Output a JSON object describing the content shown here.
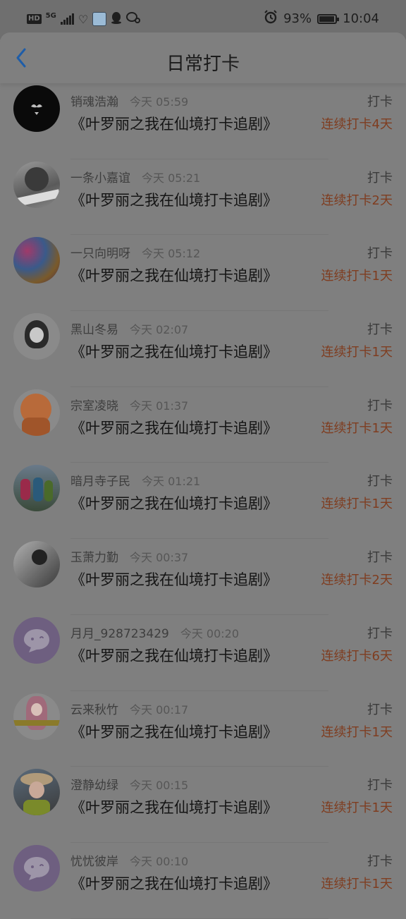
{
  "status_bar": {
    "hd": "HD",
    "network": "5G",
    "battery": "93%",
    "battery_level": 0.93,
    "time": "10:04",
    "icons": [
      "hd-icon",
      "5g-icon",
      "signal-icon",
      "heart-icon",
      "app-icon",
      "qq-icon",
      "chat-icon",
      "alarm-icon",
      "battery-icon"
    ]
  },
  "header": {
    "title": "日常打卡",
    "back_icon": "chevron-left-icon",
    "accent": "#1e5da8"
  },
  "colors": {
    "streak": "#7f3d20",
    "overlay_bg": "#7f7f7f"
  },
  "items": [
    {
      "username": "销魂浩瀚",
      "time": "今天 05:59",
      "book": "《叶罗丽之我在仙境打卡追剧》",
      "tag": "打卡",
      "streak": "连续打卡4天",
      "avatar": "mustache-avatar"
    },
    {
      "username": "一条小嘉谊",
      "time": "今天 05:21",
      "book": "《叶罗丽之我在仙境打卡追剧》",
      "tag": "打卡",
      "streak": "连续打卡2天",
      "avatar": "photo-avatar"
    },
    {
      "username": "一只向明呀",
      "time": "今天 05:12",
      "book": "《叶罗丽之我在仙境打卡追剧》",
      "tag": "打卡",
      "streak": "连续打卡1天",
      "avatar": "candy-avatar"
    },
    {
      "username": "黑山冬易",
      "time": "今天 02:07",
      "book": "《叶罗丽之我在仙境打卡追剧》",
      "tag": "打卡",
      "streak": "连续打卡1天",
      "avatar": "girl-avatar"
    },
    {
      "username": "宗室凌晓",
      "time": "今天 01:37",
      "book": "《叶罗丽之我在仙境打卡追剧》",
      "tag": "打卡",
      "streak": "连续打卡1天",
      "avatar": "cartoon-avatar"
    },
    {
      "username": "暗月寺子民",
      "time": "今天 01:21",
      "book": "《叶罗丽之我在仙境打卡追剧》",
      "tag": "打卡",
      "streak": "连续打卡1天",
      "avatar": "people-avatar"
    },
    {
      "username": "玉萧力勤",
      "time": "今天 00:37",
      "book": "《叶罗丽之我在仙境打卡追剧》",
      "tag": "打卡",
      "streak": "连续打卡2天",
      "avatar": "bw-avatar"
    },
    {
      "username": "月月_928723429",
      "time": "今天 00:20",
      "book": "《叶罗丽之我在仙境打卡追剧》",
      "tag": "打卡",
      "streak": "连续打卡6天",
      "avatar": "default-avatar"
    },
    {
      "username": "云来秋竹",
      "time": "今天 00:17",
      "book": "《叶罗丽之我在仙境打卡追剧》",
      "tag": "打卡",
      "streak": "连续打卡1天",
      "avatar": "pink-hair-avatar"
    },
    {
      "username": "澄静幼绿",
      "time": "今天 00:15",
      "book": "《叶罗丽之我在仙境打卡追剧》",
      "tag": "打卡",
      "streak": "连续打卡1天",
      "avatar": "hat-avatar"
    },
    {
      "username": "忧忧彼岸",
      "time": "今天 00:10",
      "book": "《叶罗丽之我在仙境打卡追剧》",
      "tag": "打卡",
      "streak": "连续打卡1天",
      "avatar": "default-avatar"
    }
  ]
}
